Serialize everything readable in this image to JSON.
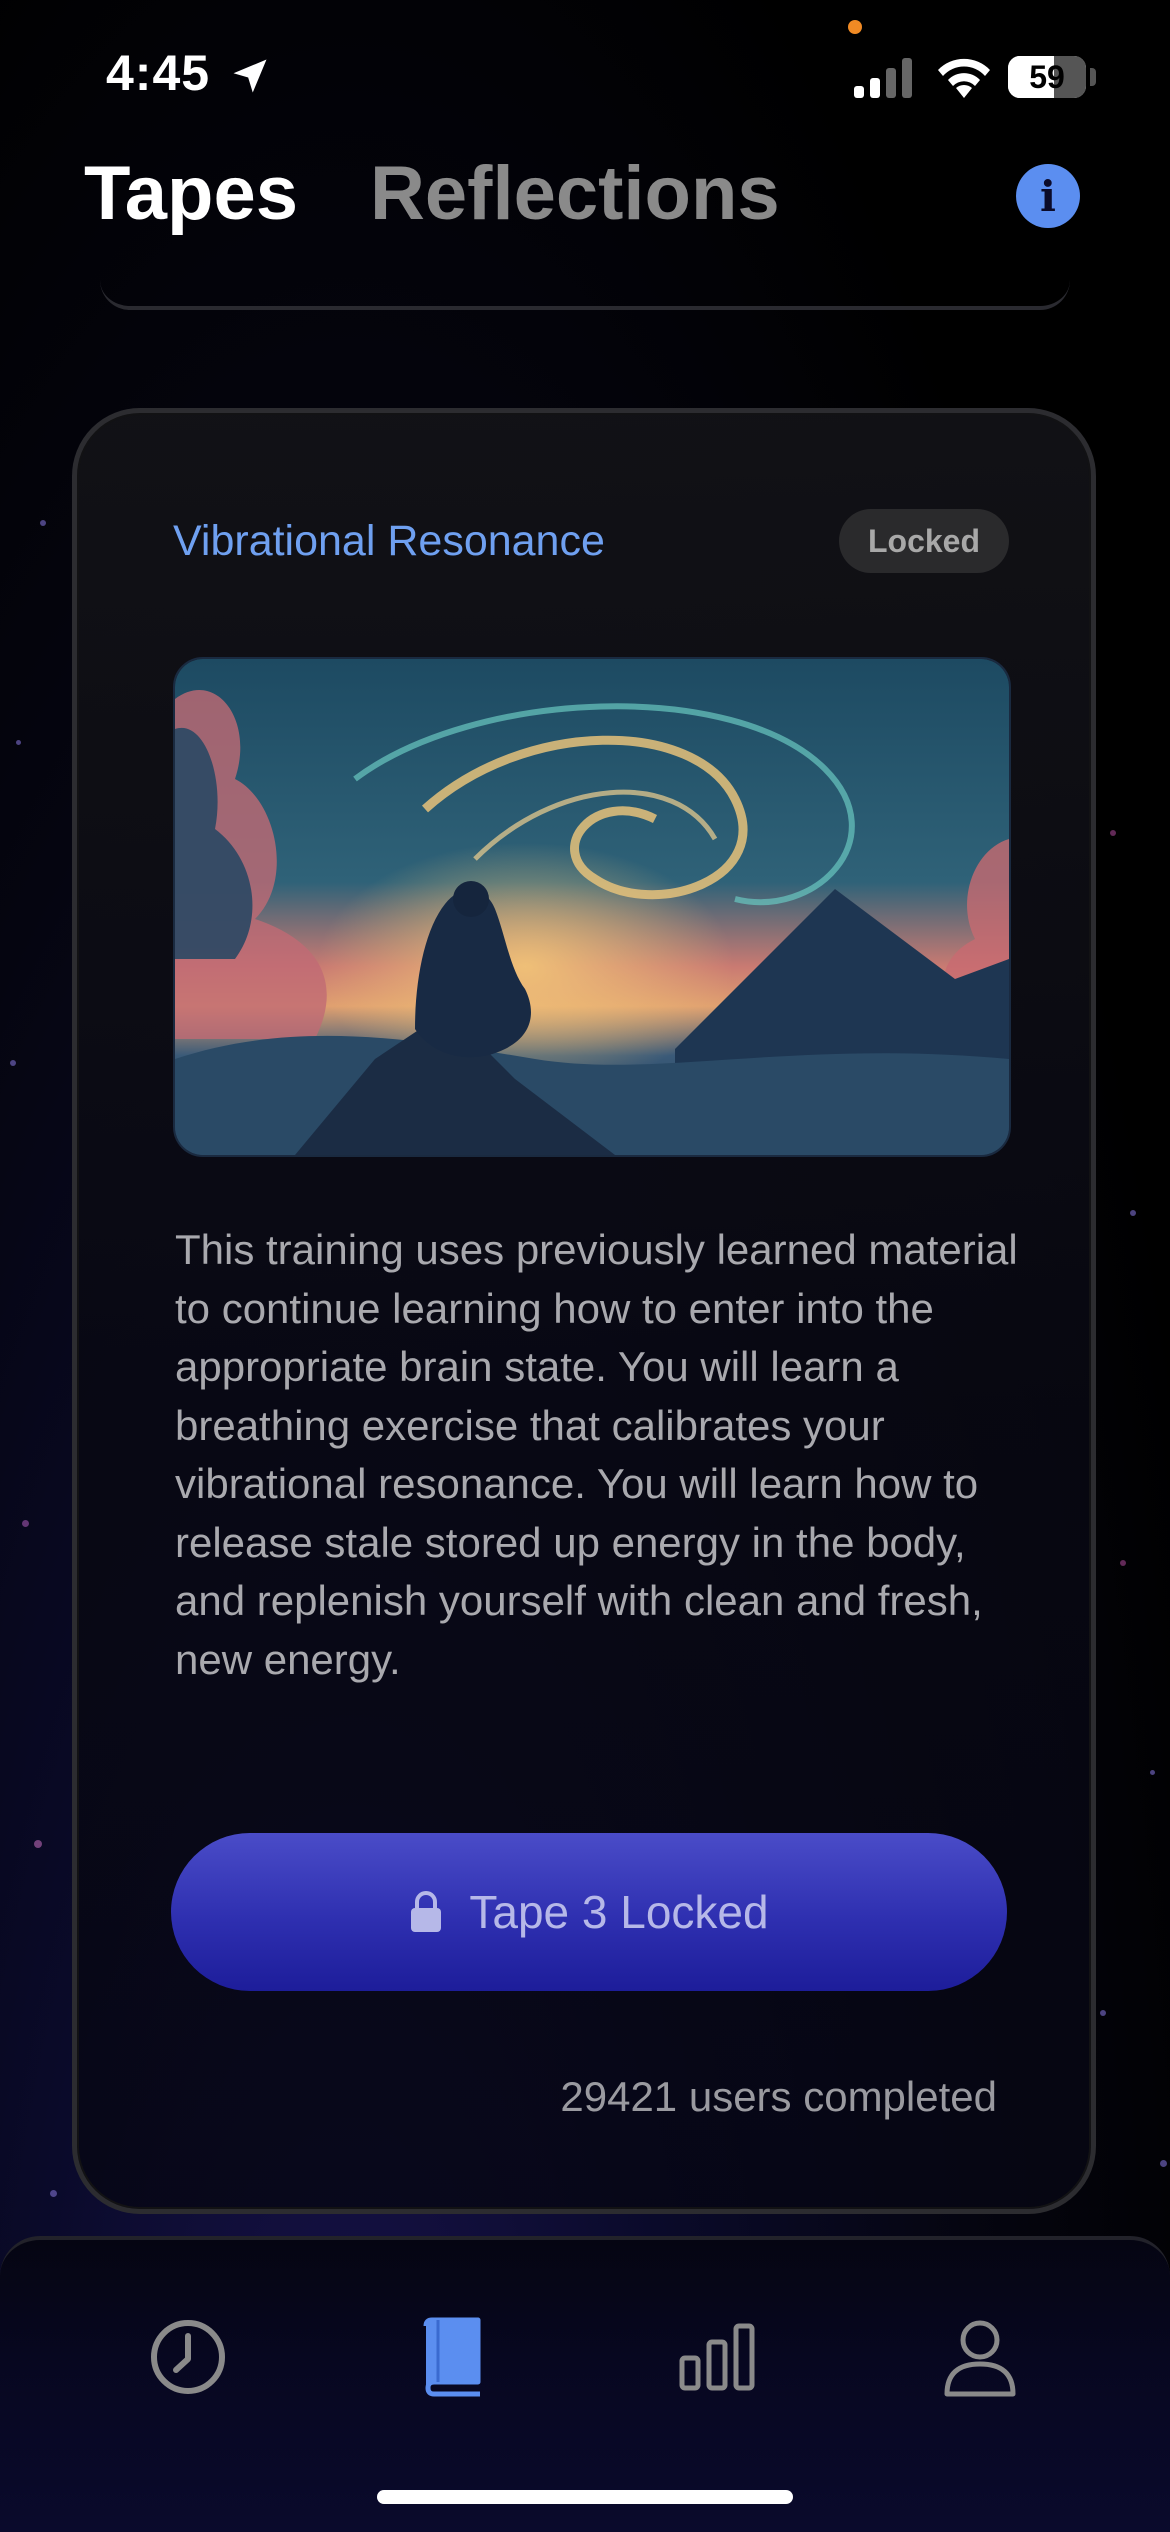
{
  "status_bar": {
    "time": "4:45",
    "battery_percent": 59,
    "icons": [
      "location-arrow-icon",
      "cellular-signal-icon",
      "wifi-icon",
      "battery-icon"
    ]
  },
  "header": {
    "tabs": [
      {
        "label": "Tapes",
        "active": true
      },
      {
        "label": "Reflections",
        "active": false
      }
    ],
    "info_button_label": "i"
  },
  "card": {
    "title": "Vibrational Resonance",
    "badge": "Locked",
    "image_icon": "meditation-mountain-image",
    "description": "This training uses previously learned material to continue learning how to enter into the appropriate brain state. You will learn a breathing exercise that calibrates your vibrational resonance. You will learn how to release stale stored up energy in the body, and replenish yourself with clean and fresh, new energy.",
    "button_label": "Tape 3 Locked",
    "users_completed": "29421 users completed"
  },
  "tab_bar": {
    "items": [
      {
        "icon": "clock-icon",
        "active": false
      },
      {
        "icon": "book-icon",
        "active": true
      },
      {
        "icon": "bar-chart-icon",
        "active": false
      },
      {
        "icon": "profile-icon",
        "active": false
      }
    ]
  },
  "colors": {
    "accent_blue": "#5b8ef0",
    "title_blue": "#6fa0f0",
    "button_indigo": "#2e2fb0",
    "inactive_icon": "#8a8a8a"
  }
}
